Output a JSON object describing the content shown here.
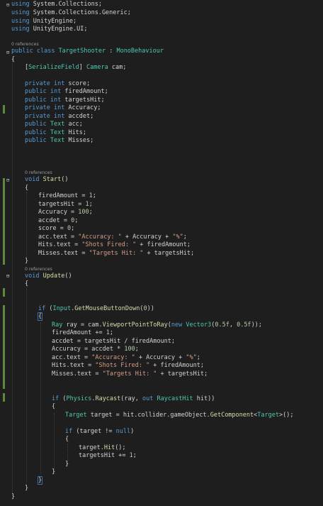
{
  "colors": {
    "background": "#1e1e1e",
    "keyword": "#569cd6",
    "type": "#4ec9b0",
    "string": "#d69d85",
    "number": "#b5cea8",
    "method": "#dcdcaa",
    "text": "#d4d4d4",
    "codelens": "#9a9a9a",
    "change_bar": "#5a8a3a"
  },
  "codelens": {
    "class_refs": "0 references",
    "start_refs": "0 references",
    "update_refs": "0 references"
  },
  "code": {
    "l1": [
      "using",
      " System.Collections;"
    ],
    "l2": [
      "using",
      " System.Collections.Generic;"
    ],
    "l3": [
      "using",
      " UnityEngine;"
    ],
    "l4": [
      "using",
      " UnityEngine.UI;"
    ],
    "l5": [
      "public",
      " ",
      "class",
      " ",
      "TargetShooter",
      " : ",
      "MonoBehaviour"
    ],
    "l6": [
      "{"
    ],
    "l7": [
      "[",
      "SerializeField",
      "] ",
      "Camera",
      " cam;"
    ],
    "l8": [
      "private",
      " ",
      "int",
      " score;"
    ],
    "l9": [
      "public",
      " ",
      "int",
      " firedAmount;"
    ],
    "l10": [
      "public",
      " ",
      "int",
      " targetsHit;"
    ],
    "l11": [
      "private",
      " ",
      "int",
      " Accuracy;"
    ],
    "l12": [
      "private",
      " ",
      "int",
      " accdet;"
    ],
    "l13": [
      "public",
      " ",
      "Text",
      " acc;"
    ],
    "l14": [
      "public",
      " ",
      "Text",
      " Hits;"
    ],
    "l15": [
      "public",
      " ",
      "Text",
      " Misses;"
    ],
    "l16": [
      "void",
      " ",
      "Start",
      "()"
    ],
    "l17": [
      "{"
    ],
    "l18": [
      "firedAmount = ",
      "1",
      ";"
    ],
    "l19": [
      "targetsHit = ",
      "1",
      ";"
    ],
    "l20": [
      "Accuracy = ",
      "100",
      ";"
    ],
    "l21": [
      "accdet = ",
      "0",
      ";"
    ],
    "l22": [
      "score = ",
      "0",
      ";"
    ],
    "l23": [
      "acc.text = ",
      "\"Accuracy: \"",
      " + Accuracy + ",
      "\"%\"",
      ";"
    ],
    "l24": [
      "Hits.text = ",
      "\"Shots Fired: \"",
      " + firedAmount;"
    ],
    "l25": [
      "Misses.text = ",
      "\"Targets Hit: \"",
      " + targetsHit;"
    ],
    "l26": [
      "}"
    ],
    "l27": [
      "void",
      " ",
      "Update",
      "()"
    ],
    "l28": [
      "{"
    ],
    "l29": [
      "if",
      " (",
      "Input",
      ".",
      "GetMouseButtonDown",
      "(",
      "0",
      "))"
    ],
    "l30": [
      "{"
    ],
    "l31": [
      "Ray",
      " ray = cam.",
      "ViewportPointToRay",
      "(",
      "new",
      " ",
      "Vector3",
      "(",
      "0.5f",
      ", ",
      "0.5f",
      "));"
    ],
    "l32": [
      "firedAmount += ",
      "1",
      ";"
    ],
    "l33": [
      "accdet = targetsHit / firedAmount;"
    ],
    "l34": [
      "Accuracy = accdet * ",
      "100",
      ";"
    ],
    "l35": [
      "acc.text = ",
      "\"Accuracy: \"",
      " + Accuracy + ",
      "\"%\"",
      ";"
    ],
    "l36": [
      "Hits.text = ",
      "\"Shots Fired: \"",
      " + firedAmount;"
    ],
    "l37": [
      "Misses.text = ",
      "\"Targets Hit: \"",
      " + targetsHit;"
    ],
    "l38": [
      "if",
      " (",
      "Physics",
      ".",
      "Raycast",
      "(ray, ",
      "out",
      " ",
      "RaycastHit",
      " hit))"
    ],
    "l39": [
      "{"
    ],
    "l40": [
      "Target",
      " target = hit.collider.gameObject.",
      "GetComponent",
      "<",
      "Target",
      ">();"
    ],
    "l41": [
      "if",
      " (target != ",
      "null",
      ")"
    ],
    "l42": [
      "{"
    ],
    "l43": [
      "target.",
      "Hit",
      "();"
    ],
    "l44": [
      "targetsHit += ",
      "1",
      ";"
    ],
    "l45": [
      "}"
    ],
    "l46": [
      "}"
    ],
    "l47": [
      "}"
    ],
    "l48": [
      "}"
    ],
    "l49": [
      "}"
    ]
  }
}
